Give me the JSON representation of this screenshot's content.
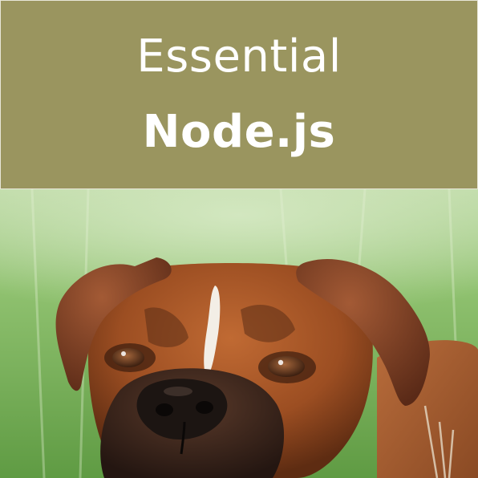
{
  "cover": {
    "title_line1": "Essential",
    "title_line2": "Node.js",
    "band_color": "#9a955f",
    "illustration": "boxer-dog-photo"
  }
}
